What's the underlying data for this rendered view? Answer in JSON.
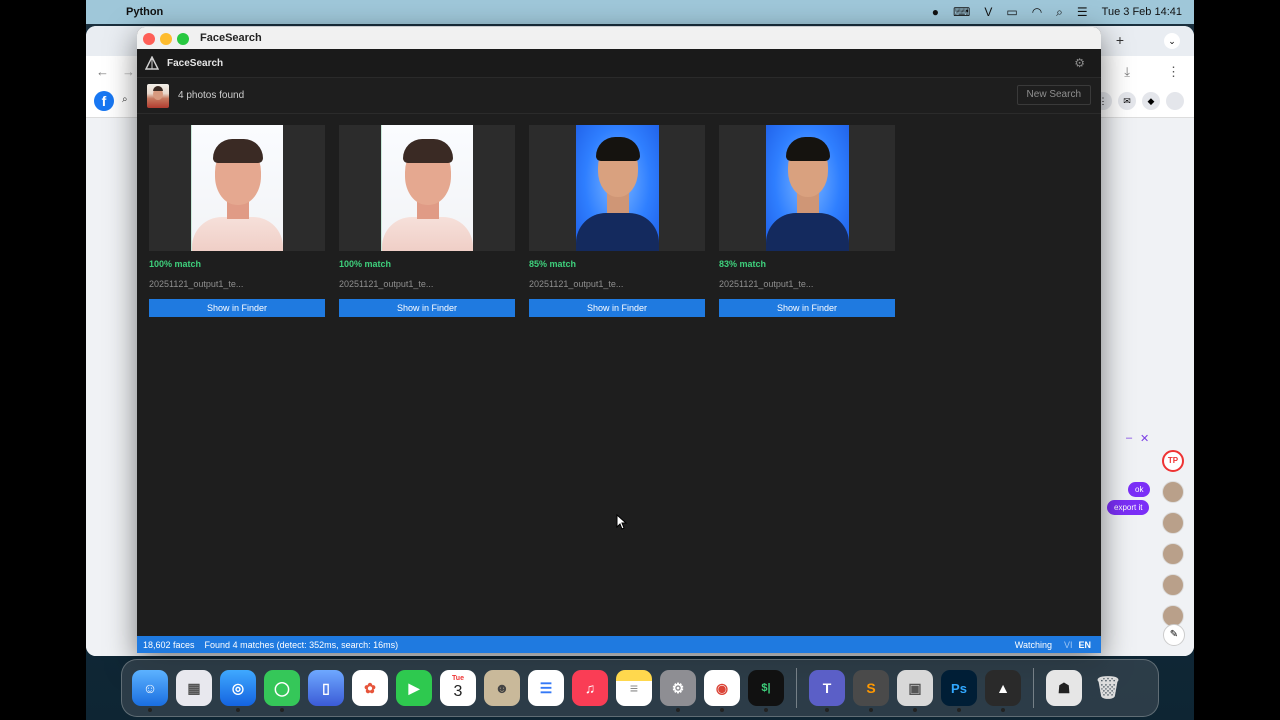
{
  "menubar": {
    "apple_glyph": "",
    "app_name": "Python",
    "datetime": "Tue 3 Feb  14:41"
  },
  "window": {
    "title": "FaceSearch"
  },
  "app": {
    "name": "FaceSearch",
    "results_summary": "4 photos found",
    "new_search_label": "New Search",
    "settings_icon": "gear-icon"
  },
  "results": [
    {
      "match": "100% match",
      "filename": "20251121_output1_te...",
      "action": "Show in Finder",
      "style": "pale"
    },
    {
      "match": "100% match",
      "filename": "20251121_output1_te...",
      "action": "Show in Finder",
      "style": "pale"
    },
    {
      "match": "85% match",
      "filename": "20251121_output1_te...",
      "action": "Show in Finder",
      "style": "blue"
    },
    {
      "match": "83% match",
      "filename": "20251121_output1_te...",
      "action": "Show in Finder",
      "style": "blue"
    }
  ],
  "status": {
    "faces": "18,602 faces",
    "message": "Found 4 matches (detect: 352ms, search: 16ms)",
    "watching": "Watching",
    "lang_vi": "VI",
    "lang_en": "EN"
  },
  "background_chat": {
    "bubble1": "ok",
    "bubble2": "export it"
  },
  "dock": {
    "calendar_month": "Tue",
    "calendar_day": "3"
  },
  "colors": {
    "accent": "#1f7ae0",
    "match_green": "#3ed07c",
    "window_bg": "#1e1e1e"
  }
}
